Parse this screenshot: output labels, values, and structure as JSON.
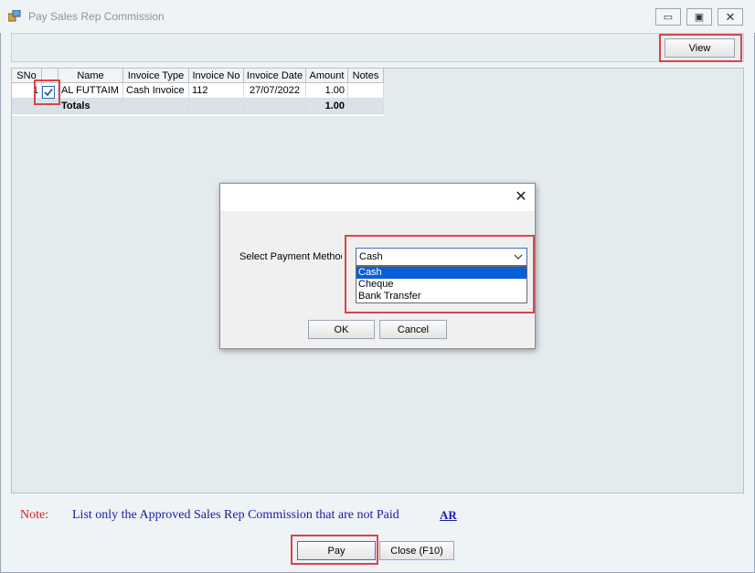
{
  "window": {
    "title": "Pay Sales Rep Commission",
    "min_glyph": "▭",
    "max_glyph": "▣",
    "close_glyph": "✕"
  },
  "toolbar": {
    "view_label": "View"
  },
  "grid": {
    "columns": [
      "SNo",
      "",
      "Name",
      "Invoice Type",
      "Invoice No",
      "Invoice Date",
      "Amount",
      "Notes"
    ],
    "rows": [
      {
        "sno": "1",
        "checked": true,
        "name": "AL FUTTAIM",
        "invoice_type": "Cash Invoice",
        "invoice_no": "112",
        "invoice_date": "27/07/2022",
        "amount": "1.00",
        "notes": ""
      }
    ],
    "totals": {
      "label": "Totals",
      "amount": "1.00"
    }
  },
  "footer": {
    "note_label": "Note:",
    "note_text": "List only the Approved Sales Rep Commission that are not Paid",
    "ar_link": "AR",
    "pay_label": "Pay",
    "close_label": "Close (F10)"
  },
  "dialog": {
    "close_glyph": "✕",
    "payment_label": "Select Payment Method",
    "selected": "Cash",
    "options": [
      "Cash",
      "Cheque",
      "Bank Transfer"
    ],
    "ok_label": "OK",
    "cancel_label": "Cancel"
  },
  "colors": {
    "highlight": "#d9454a",
    "selection": "#0a5fd8",
    "note_red": "#d42020",
    "note_blue": "#1a1aa6"
  },
  "icons": [
    "app-icon",
    "checkmark-icon",
    "chevron-down-icon",
    "close-icon"
  ]
}
